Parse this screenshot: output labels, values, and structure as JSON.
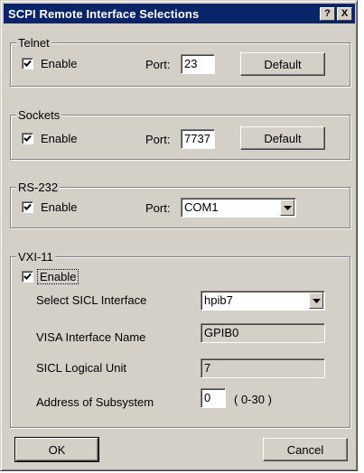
{
  "window": {
    "title": "SCPI Remote Interface Selections",
    "help_glyph": "?",
    "close_glyph": "X"
  },
  "telnet": {
    "group_label": "Telnet",
    "enable_label": "Enable",
    "enabled": true,
    "port_label": "Port:",
    "port_value": "23",
    "default_label": "Default"
  },
  "sockets": {
    "group_label": "Sockets",
    "enable_label": "Enable",
    "enabled": true,
    "port_label": "Port:",
    "port_value": "7737",
    "default_label": "Default"
  },
  "rs232": {
    "group_label": "RS-232",
    "enable_label": "Enable",
    "enabled": true,
    "port_label": "Port:",
    "port_value": "COM1"
  },
  "vxi11": {
    "group_label": "VXI-11",
    "enable_label": "Enable",
    "enabled": true,
    "sicl_interface_label": "Select SICL Interface",
    "sicl_interface_value": "hpib7",
    "visa_name_label": "VISA Interface Name",
    "visa_name_value": "GPIB0",
    "logical_unit_label": "SICL Logical Unit",
    "logical_unit_value": "7",
    "address_label": "Address of Subsystem",
    "address_value": "0",
    "address_range": "( 0-30 )"
  },
  "buttons": {
    "ok_label": "OK",
    "cancel_label": "Cancel"
  },
  "colors": {
    "titlebar": "#0a246a",
    "face": "#d4d0c8"
  }
}
